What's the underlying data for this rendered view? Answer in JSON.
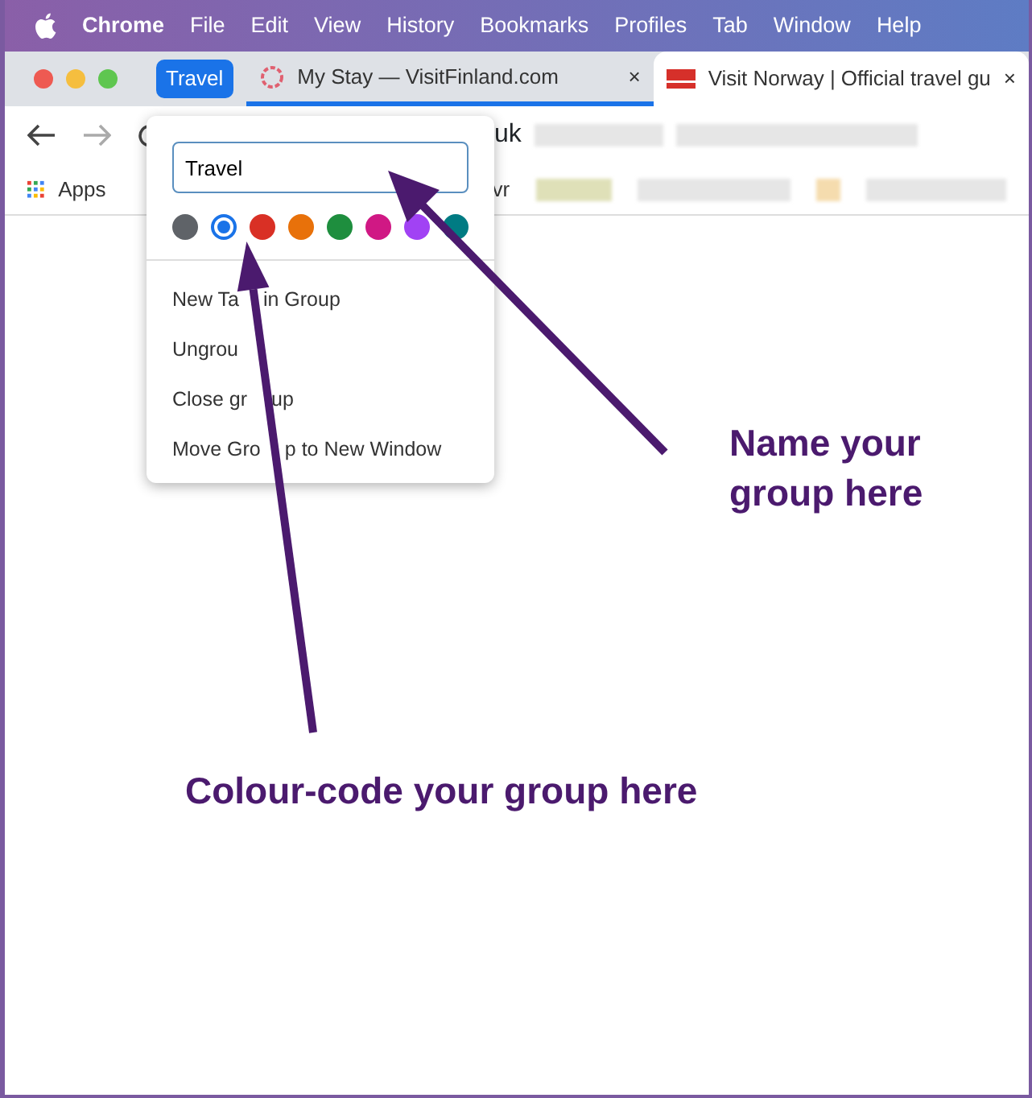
{
  "menu_bar": [
    "Chrome",
    "File",
    "Edit",
    "View",
    "History",
    "Bookmarks",
    "Profiles",
    "Tab",
    "Window",
    "Help"
  ],
  "tab_group": {
    "label": "Travel",
    "color": "#1a73e8"
  },
  "tabs": [
    {
      "title": "My Stay — VisitFinland.com",
      "close": "×",
      "selected": false
    },
    {
      "title": "Visit Norway | Official travel gu",
      "close": "×",
      "selected": true
    }
  ],
  "address_bar": {
    "text": "uk"
  },
  "bookmarks_bar": {
    "apps": "Apps",
    "fragment": "vr"
  },
  "group_editor": {
    "name_value": "Travel",
    "colors": [
      {
        "color": "#5f6368",
        "selected": false
      },
      {
        "color": "#1a73e8",
        "selected": true
      },
      {
        "color": "#d93025",
        "selected": false
      },
      {
        "color": "#e8710a",
        "selected": false
      },
      {
        "color": "#1e8e3e",
        "selected": false
      },
      {
        "color": "#d01884",
        "selected": false
      },
      {
        "color": "#a142f4",
        "selected": false
      },
      {
        "color": "#007b83",
        "selected": false
      }
    ],
    "items": [
      {
        "parts": [
          "New Ta",
          "in Group"
        ]
      },
      {
        "parts": [
          "Ungrou"
        ]
      },
      {
        "parts": [
          "Close gr",
          "up"
        ]
      },
      {
        "parts": [
          "Move Gro",
          "p to New Window"
        ]
      }
    ]
  },
  "annotations": [
    {
      "text": "Name your group here"
    },
    {
      "text": "Colour-code your group here"
    }
  ]
}
